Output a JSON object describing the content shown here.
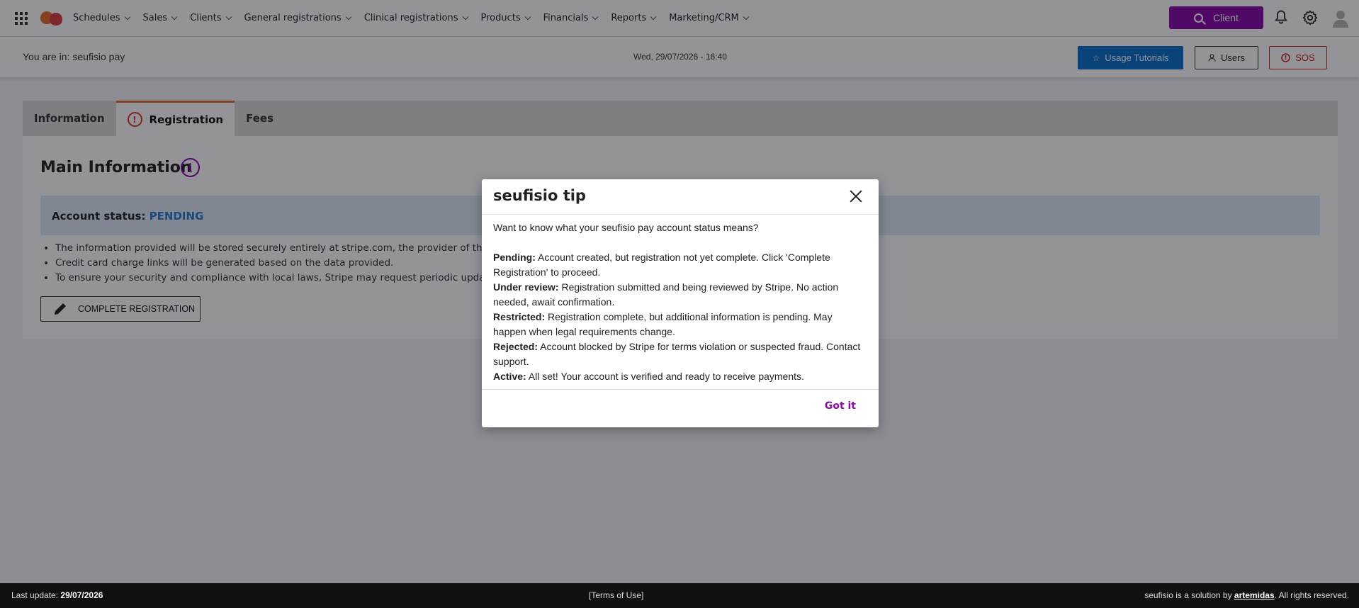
{
  "nav": {
    "items": [
      {
        "label": "Schedules"
      },
      {
        "label": "Sales"
      },
      {
        "label": "Clients"
      },
      {
        "label": "General registrations"
      },
      {
        "label": "Clinical registrations"
      },
      {
        "label": "Products"
      },
      {
        "label": "Financials"
      },
      {
        "label": "Reports"
      },
      {
        "label": "Marketing/CRM"
      }
    ],
    "client_button": "Client"
  },
  "subheader": {
    "breadcrumb": "You are in: seufisio pay",
    "datetime": "Wed, 29/07/2026 - 16:40",
    "tutorials_button": "Usage Tutorials",
    "users_button": "Users",
    "sos_button": "SOS"
  },
  "tabs": [
    {
      "label": "Information"
    },
    {
      "label": "Registration"
    },
    {
      "label": "Fees"
    }
  ],
  "main": {
    "title": "Main Information",
    "status_label": "Account status:",
    "status_value": "PENDING",
    "info_list": [
      "The information provided will be stored securely entirely at stripe.com, the provider of the payme",
      "Credit card charge links will be generated based on the data provided.",
      "To ensure your security and compliance with local laws, Stripe may request periodic updates to yo"
    ],
    "complete_button": "COMPLETE REGISTRATION"
  },
  "modal": {
    "title": "seufisio tip",
    "intro": "Want to know what your seufisio pay account status means?",
    "statuses": [
      {
        "term": "Pending:",
        "desc": " Account created, but registration not yet complete. Click 'Complete Registration' to proceed."
      },
      {
        "term": "Under review:",
        "desc": " Registration submitted and being reviewed by Stripe. No action needed, await confirmation."
      },
      {
        "term": "Restricted:",
        "desc": " Registration complete, but additional information is pending. May happen when legal requirements change."
      },
      {
        "term": "Rejected:",
        "desc": " Account blocked by Stripe for terms violation or suspected fraud. Contact support."
      },
      {
        "term": "Active:",
        "desc": " All set! Your account is verified and ready to receive payments."
      }
    ],
    "gotit_button": "Got it"
  },
  "footer": {
    "last_update_label": "Last update: ",
    "last_update_value": "29/07/2026",
    "terms": "[Terms of Use]",
    "credit_prefix": "seufisio is a solution by ",
    "credit_link": "artemidas",
    "credit_suffix": ". All rights reserved."
  },
  "colors": {
    "accent": "#8a0aa8",
    "primary": "#0b6fc9",
    "danger": "#c22222",
    "tab_active_border": "#e46f2f",
    "status_pending": "#2a7bd1"
  },
  "icons": [
    "apps-grid-icon",
    "logo",
    "chevron-down-icon",
    "search-icon",
    "bell-icon",
    "gear-icon",
    "avatar-icon",
    "star-icon",
    "user-icon",
    "alert-circle-icon",
    "warning-icon",
    "info-icon",
    "pencil-icon",
    "close-icon"
  ]
}
